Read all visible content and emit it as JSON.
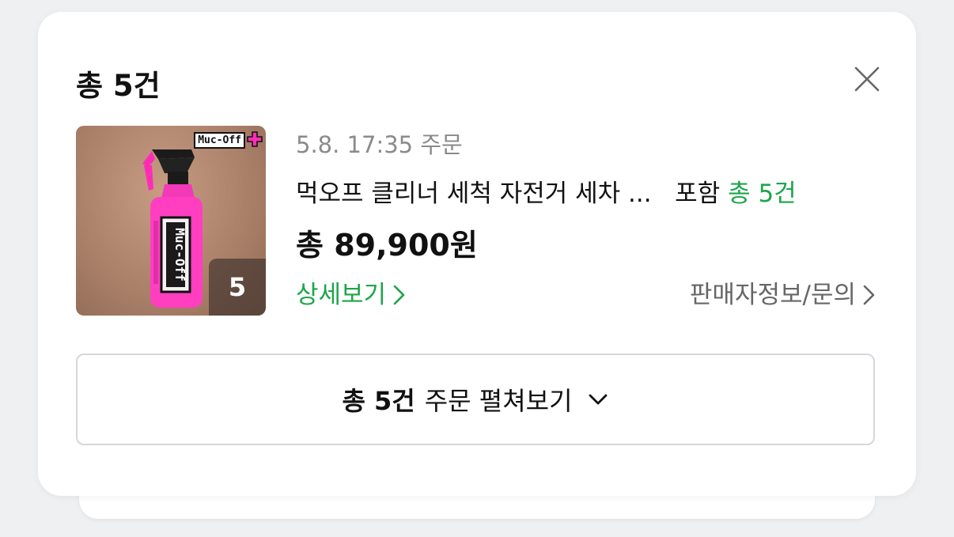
{
  "header": {
    "title": "총 5건"
  },
  "close": {
    "icon": "close-icon"
  },
  "order": {
    "image": {
      "brand_text": "Muc-Off",
      "quantity_badge": "5"
    },
    "date_text": "5.8. 17:35 주문",
    "product_name": "먹오프 클리너 세척 자전거 세차 ...",
    "include_text": "포함",
    "count_text": "총 5건",
    "total_price": "총 89,900원",
    "detail_label": "상세보기",
    "seller_label": "판매자정보/문의"
  },
  "expand_button": {
    "bold_text": "총 5건",
    "rest_text": "주문 펼쳐보기",
    "icon": "chevron-down-icon"
  },
  "colors": {
    "accent_green": "#1ea54a",
    "text_gray": "#8a8a8a",
    "badge_bg": "#46372f"
  }
}
